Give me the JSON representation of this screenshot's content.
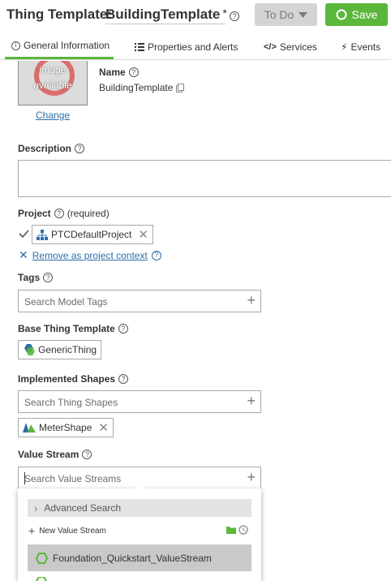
{
  "header": {
    "entity_type": "Thing Template:",
    "name": "BuildingTemplate",
    "unsaved_marker": "*",
    "todo_label": "To Do",
    "save_label": "Save"
  },
  "tabs": [
    {
      "label": "General Information",
      "icon": "info-icon",
      "active": true
    },
    {
      "label": "Properties and Alerts",
      "icon": "list-icon"
    },
    {
      "label": "Services",
      "icon": "code-icon"
    },
    {
      "label": "Events",
      "icon": "lightning-icon"
    }
  ],
  "image": {
    "placeholder_line1": "image",
    "placeholder_line2": "available",
    "change_link": "Change"
  },
  "name_field": {
    "label": "Name",
    "value": "BuildingTemplate"
  },
  "description": {
    "label": "Description",
    "value": ""
  },
  "project": {
    "label": "Project",
    "required_text": "(required)",
    "value": "PTCDefaultProject",
    "remove_link": "Remove as project context"
  },
  "tags": {
    "label": "Tags",
    "placeholder": "Search Model Tags"
  },
  "base_template": {
    "label": "Base Thing Template",
    "value": "GenericThing"
  },
  "shapes": {
    "label": "Implemented Shapes",
    "placeholder": "Search Thing Shapes",
    "items": [
      "MeterShape"
    ]
  },
  "value_stream": {
    "label": "Value Stream",
    "placeholder": "Search Value Streams",
    "advanced_search": "Advanced Search",
    "new_label": "New Value Stream",
    "results": [
      "Foundation_Quickstart_ValueStream"
    ]
  },
  "colors": {
    "accent_green": "#5bb73b",
    "link_blue": "#2d6ea8"
  }
}
